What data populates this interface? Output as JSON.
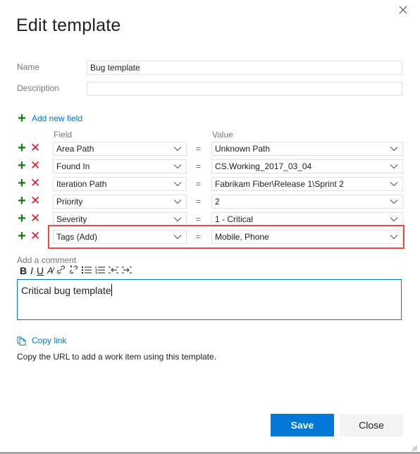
{
  "dialog": {
    "title": "Edit template",
    "close_icon": "close-icon"
  },
  "form": {
    "name_label": "Name",
    "name_value": "Bug template",
    "description_label": "Description",
    "description_value": ""
  },
  "fields": {
    "add_new_label": "Add new field",
    "field_header": "Field",
    "value_header": "Value",
    "operator": "=",
    "rows": [
      {
        "field": "Area Path",
        "value": "Unknown Path",
        "highlighted": false
      },
      {
        "field": "Found In",
        "value": "CS.Working_2017_03_04",
        "highlighted": false
      },
      {
        "field": "Iteration Path",
        "value": "Fabrikam Fiber\\Release 1\\Sprint 2",
        "highlighted": false
      },
      {
        "field": "Priority",
        "value": "2",
        "highlighted": false
      },
      {
        "field": "Severity",
        "value": "1 - Critical",
        "highlighted": false
      },
      {
        "field": "Tags (Add)",
        "value": "Mobile, Phone",
        "highlighted": true
      }
    ]
  },
  "comment": {
    "label": "Add a comment",
    "toolbar": [
      "bold",
      "italic",
      "underline",
      "highlight",
      "link",
      "unlink",
      "bulleted-list",
      "numbered-list",
      "decrease-indent",
      "increase-indent"
    ],
    "text": "Critical bug template"
  },
  "copy_link": {
    "label": "Copy link",
    "description": "Copy the URL to add a work item using this template."
  },
  "buttons": {
    "save": "Save",
    "close": "Close"
  },
  "colors": {
    "accent": "#0078d4",
    "add": "#107c10",
    "remove": "#e81123",
    "highlight_border": "#e74c3c"
  }
}
